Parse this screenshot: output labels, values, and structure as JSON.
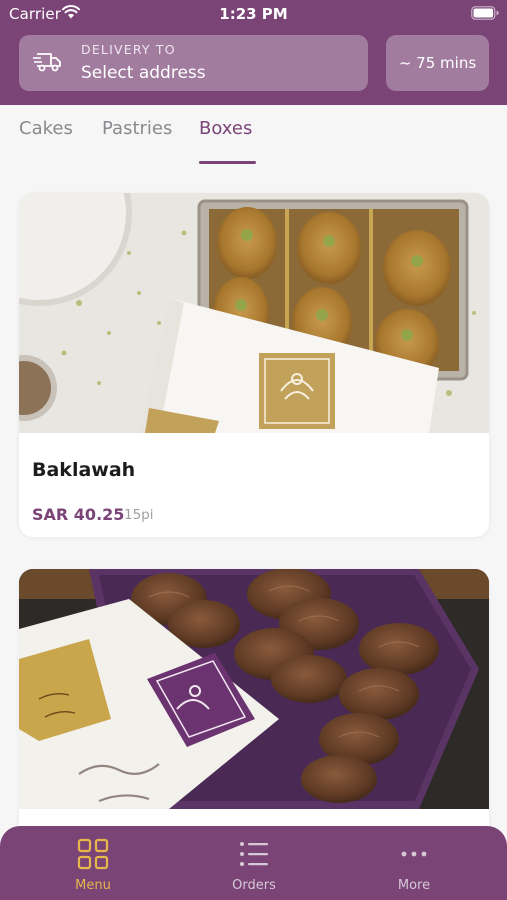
{
  "status_bar": {
    "carrier": "Carrier",
    "time": "1:23 PM"
  },
  "header": {
    "delivery_label": "DELIVERY TO",
    "delivery_value": "Select address",
    "delivery_time": "~ 75 mins"
  },
  "tabs": [
    {
      "label": "Cakes",
      "active": false
    },
    {
      "label": "Pastries",
      "active": false
    },
    {
      "label": "Boxes",
      "active": true
    }
  ],
  "products": [
    {
      "name": "Baklawah",
      "price": "SAR 40.25",
      "quantity": "15pi"
    }
  ],
  "bottom_nav": [
    {
      "label": "Menu",
      "icon": "grid-icon",
      "active": true
    },
    {
      "label": "Orders",
      "icon": "list-icon",
      "active": false
    },
    {
      "label": "More",
      "icon": "more-dots-icon",
      "active": false
    }
  ],
  "colors": {
    "brand": "#7a4477",
    "header_box": "#a27c9f",
    "active_nav": "#e6b74a",
    "background": "#f6f6f7"
  }
}
